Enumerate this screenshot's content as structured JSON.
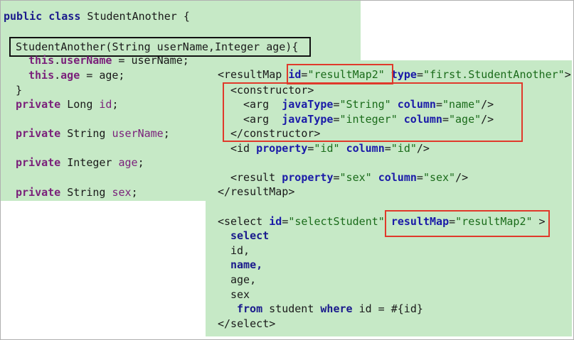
{
  "java": {
    "class_kw1": "public",
    "class_kw2": "class",
    "class_name": "StudentAnother {",
    "ctor_sig": "StudentAnother(String userName,Integer age){",
    "this1_kw": "this",
    "this1_dot": ".",
    "this1_field": "userName",
    "this1_rest": " = userName;",
    "this2_kw": "this",
    "this2_dot": ".",
    "this2_field": "age",
    "this2_rest": " = age;",
    "close_brace": "}",
    "f1_kw": "private",
    "f1_type": " Long ",
    "f1_name": "id",
    "f1_end": ";",
    "f2_kw": "private",
    "f2_type": " String ",
    "f2_name": "userName",
    "f2_end": ";",
    "f3_kw": "private",
    "f3_type": " Integer ",
    "f3_name": "age",
    "f3_end": ";",
    "f4_kw": "private",
    "f4_type": " String ",
    "f4_name": "sex",
    "f4_end": ";"
  },
  "xml": {
    "rm_open": "<resultMap ",
    "rm_id_attr": "id",
    "rm_id_eq": "=",
    "rm_id_val": "\"resultMap2\"",
    "rm_type_attr": " type",
    "rm_type_eq": "=",
    "rm_type_val": "\"first.StudentAnother\"",
    "rm_gt": ">",
    "ctor_open": "<constructor>",
    "arg1_tag": "<arg",
    "arg1_jt": "javaType",
    "arg1_jt_val": "\"String\"",
    "arg1_col": "column",
    "arg1_col_val": "\"name\"",
    "arg1_end": "/>",
    "arg2_tag": "<arg",
    "arg2_jt": "javaType",
    "arg2_jt_val": "\"integer\"",
    "arg2_col": "column",
    "arg2_col_val": "\"age\"",
    "arg2_end": "/>",
    "ctor_close": "</constructor>",
    "id_tag": "<id",
    "id_prop": "property",
    "id_prop_val": "\"id\"",
    "id_col": "column",
    "id_col_val": "\"id\"",
    "id_end": "/>",
    "res_tag": "<result",
    "res_prop": "property",
    "res_prop_val": "\"sex\"",
    "res_col": "column",
    "res_col_val": "\"sex\"",
    "res_end": "/>",
    "rm_close": "</resultMap>",
    "sel_tag": "<select",
    "sel_id": "id",
    "sel_id_val": "\"selectStudent\"",
    "sel_rm": "resultMap",
    "sel_rm_val": "\"resultMap2\"",
    "sel_gt": " >",
    "sql1": "select",
    "sql2": "id,",
    "sql3": "name,",
    "sql4": "age,",
    "sql5": "sex",
    "sql6_from": "from",
    "sql6_mid": " student ",
    "sql6_where": "where",
    "sql6_rest": " id = #{id}",
    "sel_close": "</select>"
  }
}
